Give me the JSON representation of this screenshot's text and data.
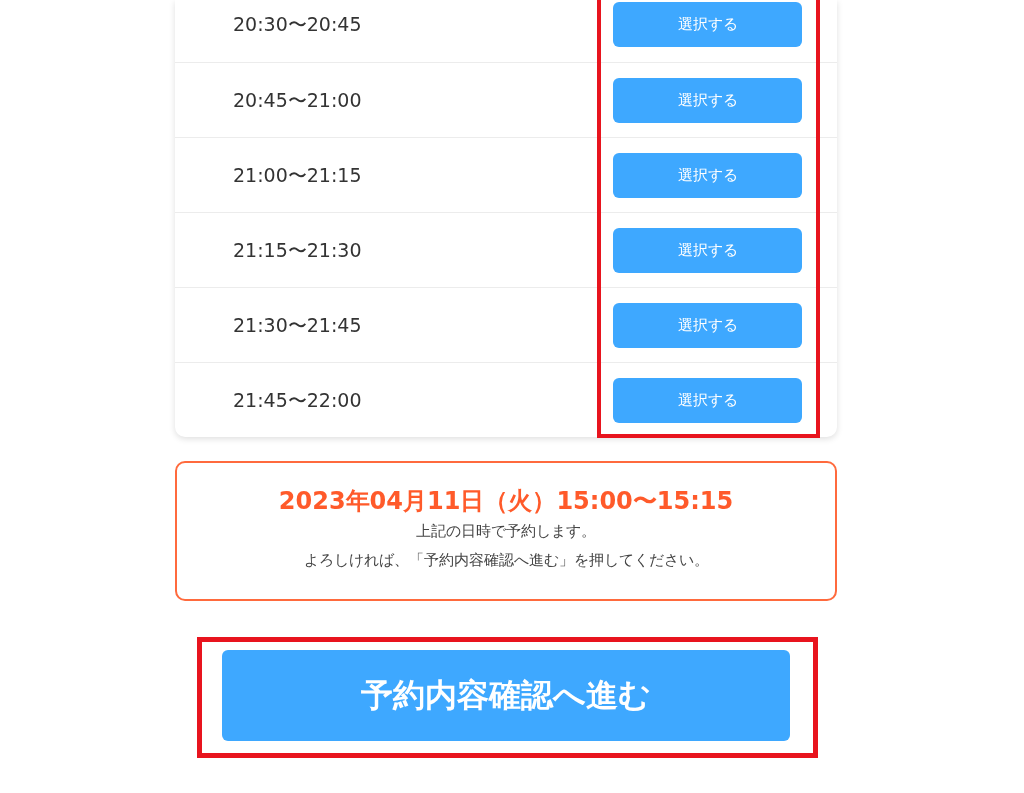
{
  "time_slots": [
    {
      "time": "20:30〜20:45",
      "button": "選択する"
    },
    {
      "time": "20:45〜21:00",
      "button": "選択する"
    },
    {
      "time": "21:00〜21:15",
      "button": "選択する"
    },
    {
      "time": "21:15〜21:30",
      "button": "選択する"
    },
    {
      "time": "21:30〜21:45",
      "button": "選択する"
    },
    {
      "time": "21:45〜22:00",
      "button": "選択する"
    }
  ],
  "slot_buttons_highlighted": true,
  "summary": {
    "datetime": "2023年04月11日（火）15:00〜15:15",
    "lines": [
      "上記の日時で予約します。",
      "よろしければ、「予約内容確認へ進む」を押してください。"
    ]
  },
  "proceed_button": {
    "label": "予約内容確認へ進む",
    "highlighted": true
  }
}
